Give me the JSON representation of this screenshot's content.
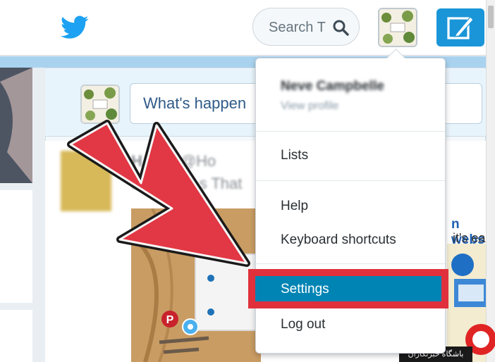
{
  "topbar": {
    "search_placeholder": "Search T",
    "icons": {
      "logo": "twitter-bird-icon",
      "search": "search-icon",
      "compose": "compose-tweet-icon"
    }
  },
  "composer": {
    "placeholder": "What's happen"
  },
  "timeline": {
    "tweet_name": "H   ator",
    "tweet_handle": "@Ho",
    "tweet_text": "th Your C        s That",
    "ad_line1": "n webs",
    "ad_line2": "it's ea"
  },
  "menu": {
    "profile_name": "Neve Campbelle",
    "profile_sub": "View profile",
    "items": {
      "lists": "Lists",
      "help": "Help",
      "keyboard_shortcuts": "Keyboard shortcuts",
      "settings": "Settings",
      "logout": "Log out"
    }
  },
  "watermark": {
    "text": "باشگاه خبرنگاران"
  },
  "colors": {
    "brand_blue": "#1da1f2",
    "highlight_red": "#e0303c",
    "settings_bg": "#0084b4",
    "arrow_red": "#e23744"
  }
}
